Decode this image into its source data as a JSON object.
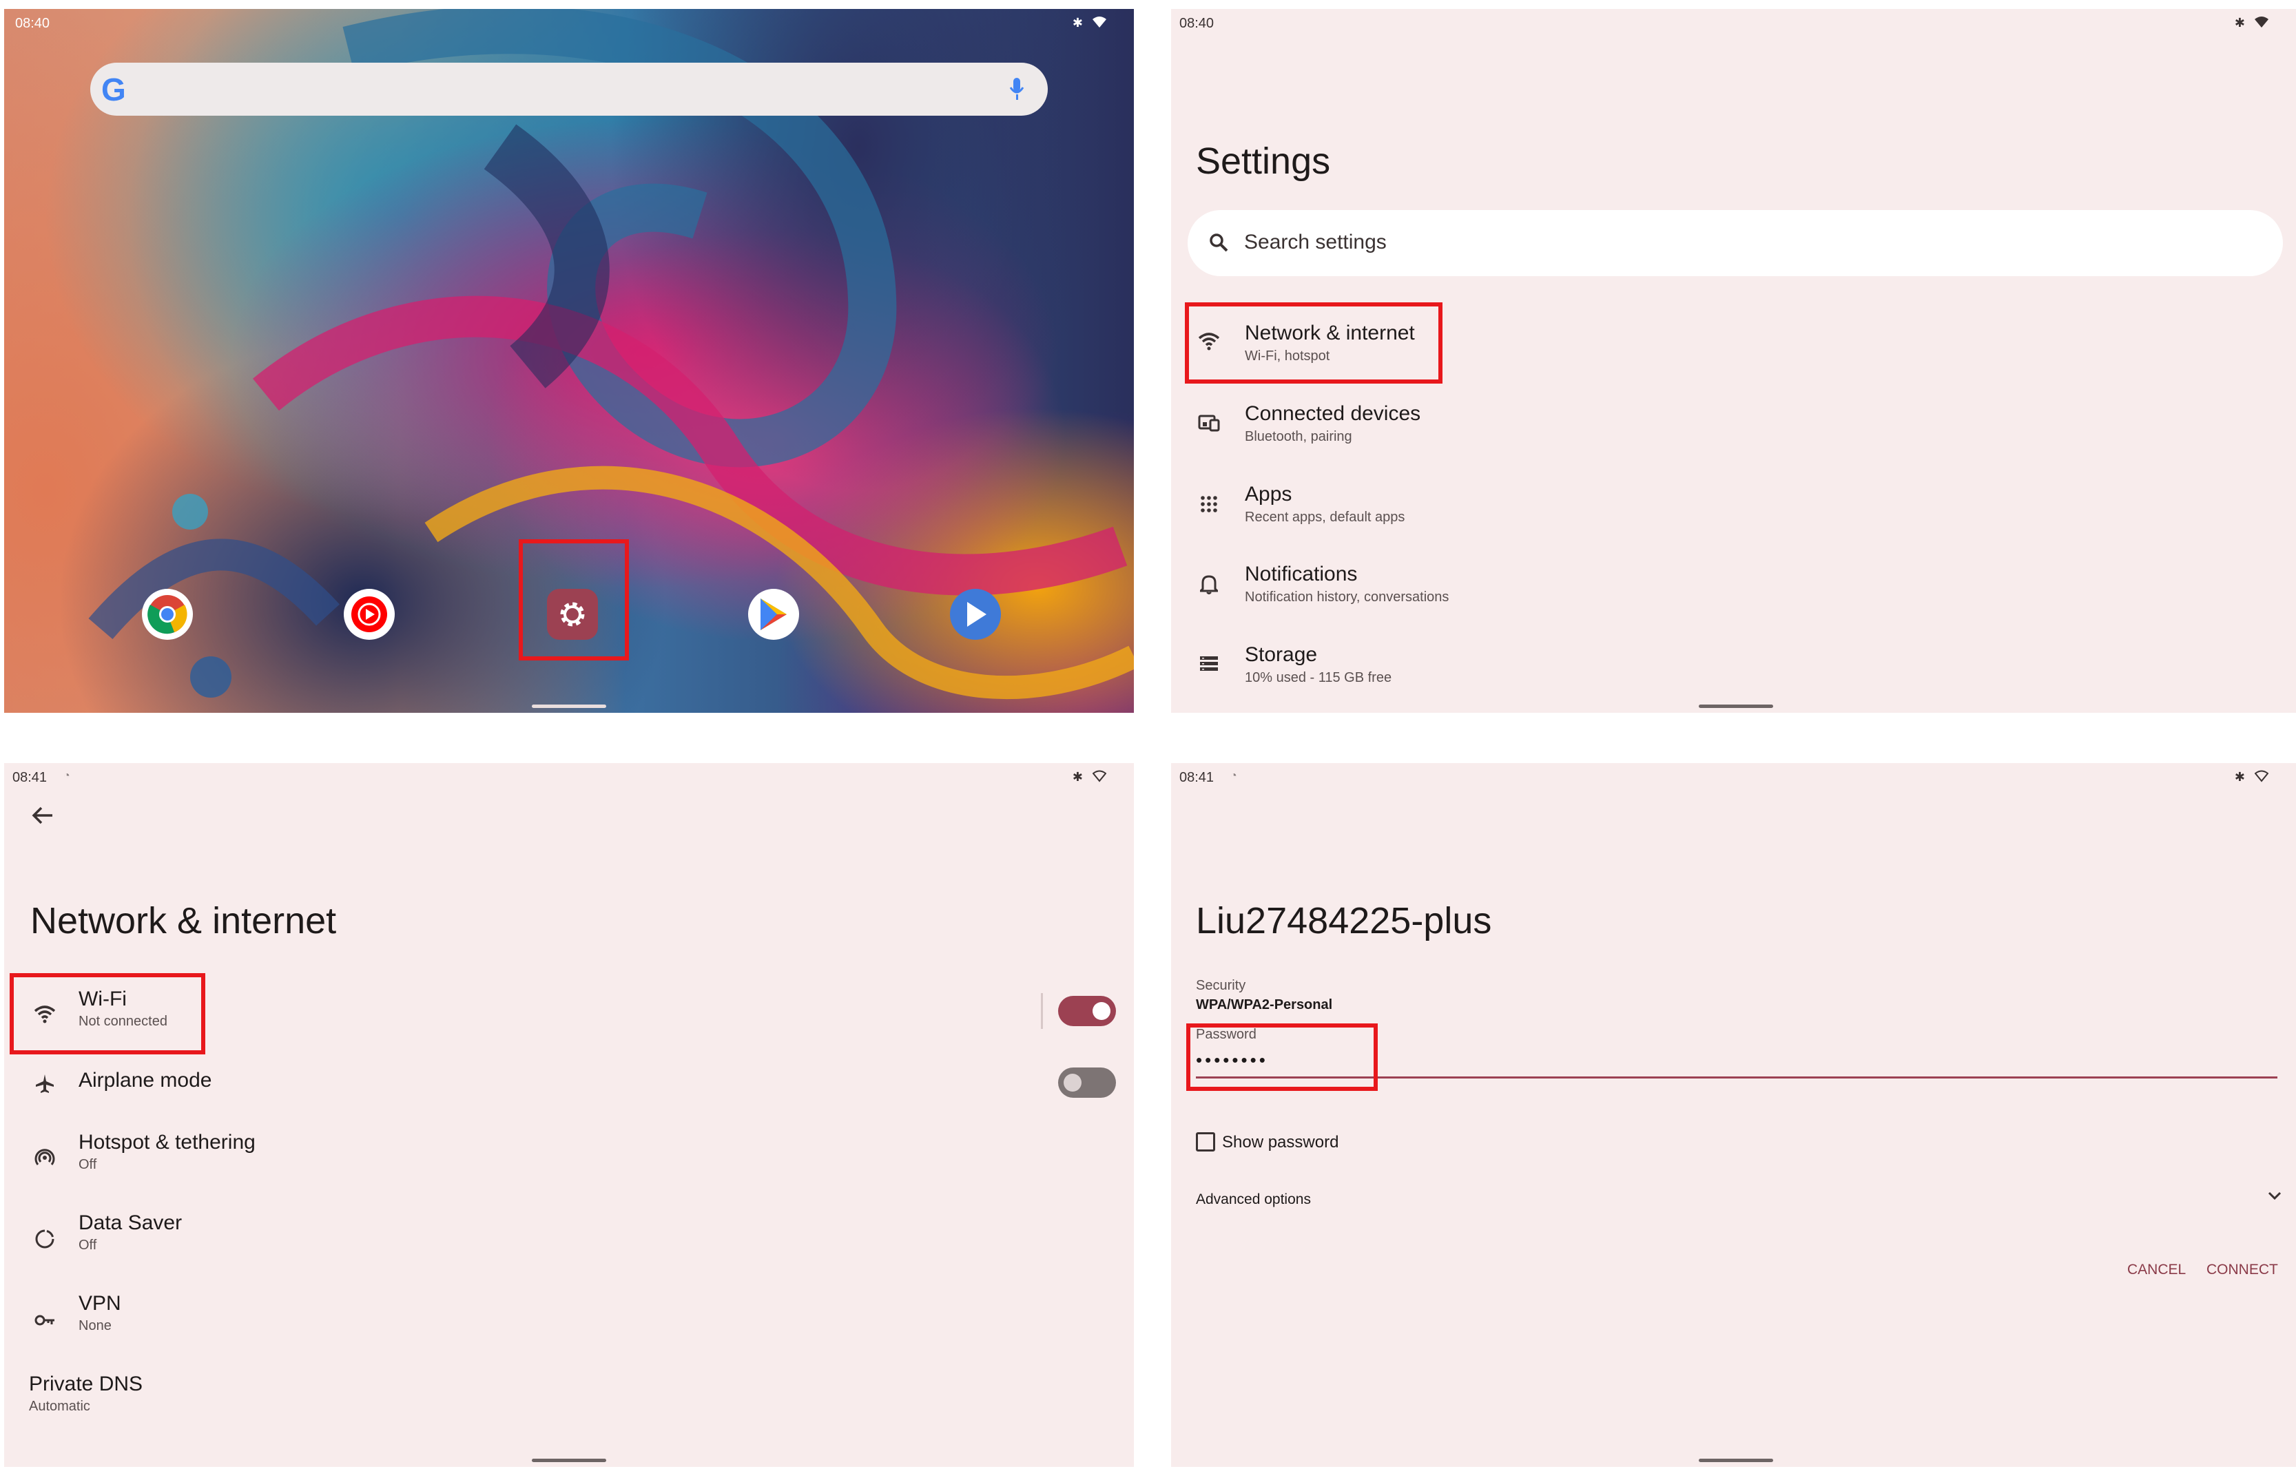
{
  "home": {
    "time": "08:40",
    "search_logo": "G",
    "dock": [
      {
        "name": "Chrome",
        "icon": "chrome-icon"
      },
      {
        "name": "YouTube Music",
        "icon": "youtube-music-icon"
      },
      {
        "name": "Settings",
        "icon": "gear-icon"
      },
      {
        "name": "Play Store",
        "icon": "play-store-icon"
      },
      {
        "name": "Play Video",
        "icon": "play-video-icon"
      }
    ]
  },
  "settings": {
    "time": "08:40",
    "title": "Settings",
    "search_placeholder": "Search settings",
    "items": [
      {
        "title": "Network & internet",
        "subtitle": "Wi-Fi, hotspot",
        "icon": "wifi-icon"
      },
      {
        "title": "Connected devices",
        "subtitle": "Bluetooth, pairing",
        "icon": "connected-devices-icon"
      },
      {
        "title": "Apps",
        "subtitle": "Recent apps, default apps",
        "icon": "apps-grid-icon"
      },
      {
        "title": "Notifications",
        "subtitle": "Notification history, conversations",
        "icon": "bell-icon"
      },
      {
        "title": "Storage",
        "subtitle": "10% used - 115 GB free",
        "icon": "storage-icon"
      }
    ]
  },
  "network": {
    "time": "08:41",
    "title": "Network & internet",
    "items": [
      {
        "title": "Wi-Fi",
        "subtitle": "Not connected",
        "icon": "wifi-icon",
        "toggle": true
      },
      {
        "title": "Airplane mode",
        "icon": "airplane-icon",
        "toggle": false
      },
      {
        "title": "Hotspot & tethering",
        "subtitle": "Off",
        "icon": "hotspot-icon"
      },
      {
        "title": "Data Saver",
        "subtitle": "Off",
        "icon": "data-saver-icon"
      },
      {
        "title": "VPN",
        "subtitle": "None",
        "icon": "vpn-key-icon"
      },
      {
        "title": "Private DNS",
        "subtitle": "Automatic"
      }
    ]
  },
  "wifi_dialog": {
    "time": "08:41",
    "ssid": "Liu27484225-plus",
    "security_label": "Security",
    "security_value": "WPA/WPA2-Personal",
    "password_label": "Password",
    "password_value": "••••••••",
    "show_password_label": "Show password",
    "show_password_checked": false,
    "advanced_label": "Advanced options",
    "cancel_label": "CANCEL",
    "connect_label": "CONNECT"
  },
  "colors": {
    "highlight": "#e8181c",
    "toggle_on": "#9c4152",
    "toggle_off": "#7d7474",
    "accent_text": "#8a3a48",
    "panel_bg": "#f8ecec"
  }
}
